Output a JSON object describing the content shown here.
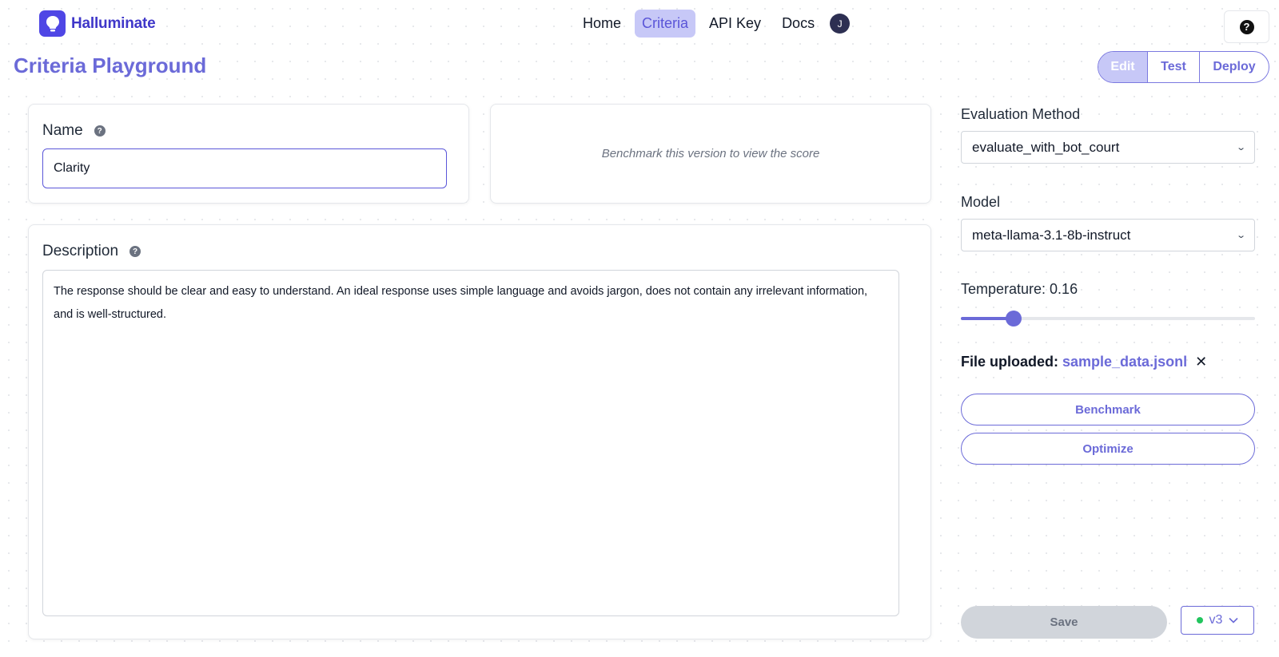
{
  "app": {
    "name": "Halluminate"
  },
  "nav": {
    "items": [
      {
        "label": "Home",
        "active": false
      },
      {
        "label": "Criteria",
        "active": true
      },
      {
        "label": "API Key",
        "active": false
      },
      {
        "label": "Docs",
        "active": false
      }
    ],
    "avatar_initial": "J"
  },
  "help": {
    "icon": "question-circle-icon",
    "glyph": "?"
  },
  "page": {
    "title": "Criteria Playground"
  },
  "modes": [
    {
      "label": "Edit",
      "active": true
    },
    {
      "label": "Test",
      "active": false
    },
    {
      "label": "Deploy",
      "active": false
    }
  ],
  "name_card": {
    "label": "Name",
    "value": "Clarity"
  },
  "score_card": {
    "message": "Benchmark this version to view the score"
  },
  "description_card": {
    "label": "Description",
    "value": "The response should be clear and easy to understand. An ideal response uses simple language and avoids jargon, does not contain any irrelevant information, and is well-structured."
  },
  "settings": {
    "evaluation_method": {
      "label": "Evaluation Method",
      "value": "evaluate_with_bot_court"
    },
    "model": {
      "label": "Model",
      "value": "meta-llama-3.1-8b-instruct"
    },
    "temperature": {
      "label": "Temperature: 0.16",
      "value": 0.16,
      "min": 0,
      "max": 1
    },
    "file": {
      "label": "File uploaded:",
      "name": "sample_data.jsonl",
      "remove_glyph": "✕"
    }
  },
  "actions": {
    "benchmark": "Benchmark",
    "optimize": "Optimize",
    "save": "Save",
    "version": "v3"
  },
  "colors": {
    "accent": "#6b6ad8",
    "brand": "#4f46e5",
    "status_ok": "#22c55e"
  }
}
